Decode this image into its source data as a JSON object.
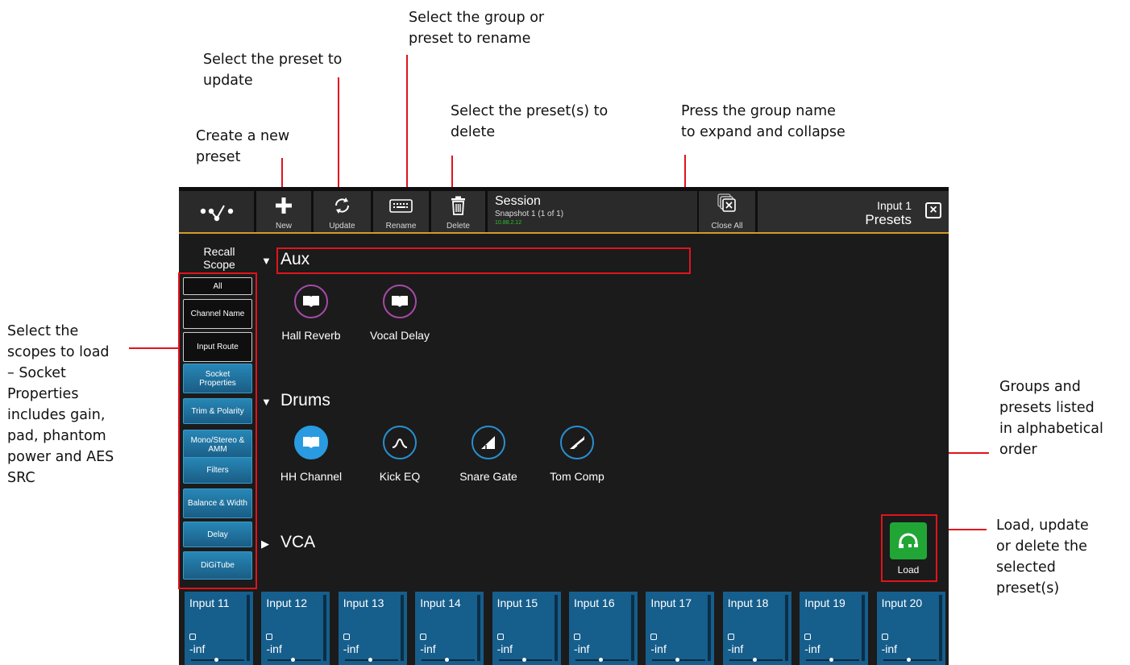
{
  "annotations": {
    "create": "Create a new\npreset",
    "update": "Select the preset to\nupdate",
    "rename": "Select the group or\npreset to rename",
    "delete": "Select the preset(s) to\ndelete",
    "expand": "Press the group name\nto expand and collapse",
    "scopes": "Select the\nscopes to load\n– Socket\nProperties\nincludes gain,\npad, phantom\npower and AES\nSRC",
    "groups": "Groups and\npresets listed\nin alphabetical\norder",
    "load": "Load, update\nor delete the\nselected\npreset(s)"
  },
  "toolbar": {
    "new_label": "New",
    "update_label": "Update",
    "rename_label": "Rename",
    "delete_label": "Delete",
    "close_all_label": "Close All"
  },
  "session": {
    "title": "Session",
    "snapshot": "Snapshot 1 (1 of 1)",
    "ip": "10.88.2.12"
  },
  "header": {
    "channel": "Input 1",
    "title": "Presets"
  },
  "recall_scope": {
    "title": "Recall\nScope",
    "items": [
      {
        "label": "All",
        "active": false
      },
      {
        "label": "Channel Name",
        "active": false
      },
      {
        "label": "Input Route",
        "active": false
      },
      {
        "label": "Socket\nProperties",
        "active": true
      },
      {
        "label": "Trim & Polarity",
        "active": true
      },
      {
        "label": "Mono/Stereo &\nAMM",
        "active": true
      },
      {
        "label": "Filters",
        "active": true
      },
      {
        "label": "Balance & Width",
        "active": true
      },
      {
        "label": "Delay",
        "active": true
      },
      {
        "label": "DiGiTube",
        "active": true
      }
    ]
  },
  "groups": [
    {
      "name": "Aux",
      "expanded": true,
      "presets": [
        {
          "label": "Hall Reverb",
          "icon": "book-icon"
        },
        {
          "label": "Vocal Delay",
          "icon": "book-icon"
        }
      ]
    },
    {
      "name": "Drums",
      "expanded": true,
      "presets": [
        {
          "label": "HH Channel",
          "icon": "book-icon"
        },
        {
          "label": "Kick EQ",
          "icon": "eq-curve-icon"
        },
        {
          "label": "Snare Gate",
          "icon": "gate-icon"
        },
        {
          "label": "Tom Comp",
          "icon": "compressor-icon"
        }
      ]
    },
    {
      "name": "VCA",
      "expanded": false,
      "presets": []
    }
  ],
  "load_label": "Load",
  "strips": [
    {
      "name": "Input 11",
      "value": "-inf"
    },
    {
      "name": "Input 12",
      "value": "-inf"
    },
    {
      "name": "Input 13",
      "value": "-inf"
    },
    {
      "name": "Input 14",
      "value": "-inf"
    },
    {
      "name": "Input 15",
      "value": "-inf"
    },
    {
      "name": "Input 16",
      "value": "-inf"
    },
    {
      "name": "Input 17",
      "value": "-inf"
    },
    {
      "name": "Input 18",
      "value": "-inf"
    },
    {
      "name": "Input 19",
      "value": "-inf"
    },
    {
      "name": "Input 20",
      "value": "-inf"
    }
  ],
  "colors": {
    "accent": "#d49a2c",
    "scope_active": "#2787b6",
    "strip": "#165e8c",
    "load": "#21a636",
    "annotation": "#e0141d"
  }
}
